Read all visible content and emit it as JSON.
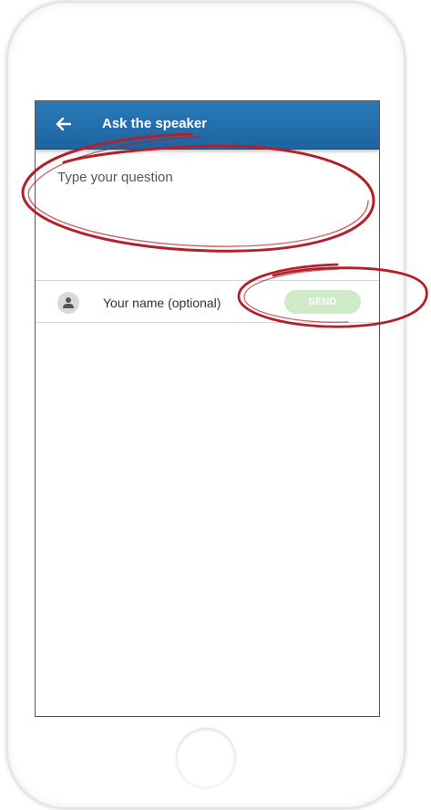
{
  "app_bar": {
    "title": "Ask the speaker",
    "back_icon": "arrow-left-icon",
    "background": "#1f6aa6"
  },
  "question": {
    "placeholder": "Type your question",
    "value": ""
  },
  "name_field": {
    "icon": "person-icon",
    "placeholder": "Your name (optional)",
    "value": ""
  },
  "send_button": {
    "label": "SEND",
    "enabled": false,
    "color": "#cfeac8"
  },
  "annotation_color": "#b3202a"
}
